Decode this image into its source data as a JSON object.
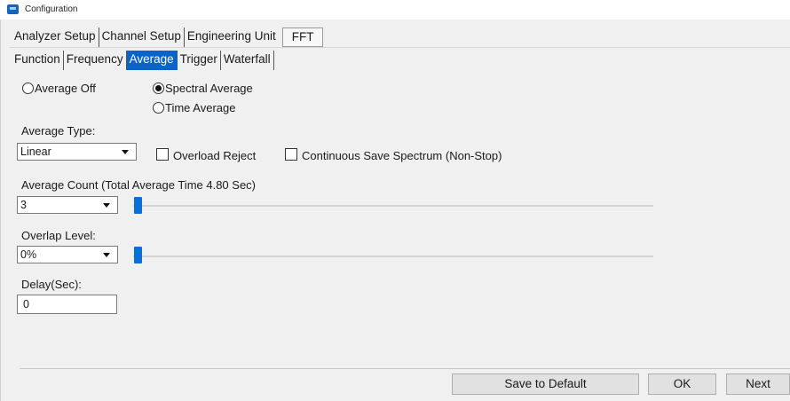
{
  "window": {
    "title": "Configuration",
    "icon": "app-window-icon"
  },
  "tabs_top": [
    "Analyzer Setup",
    "Channel Setup",
    "Engineering Unit",
    "FFT"
  ],
  "tabs_sub": [
    "Function",
    "Frequency",
    "Average",
    "Trigger",
    "Waterfall"
  ],
  "active_sub_tab": "Average",
  "mode": {
    "average_off": "Average Off",
    "spectral_average": "Spectral Average",
    "time_average": "Time Average",
    "selected": "Spectral Average"
  },
  "average_type": {
    "label": "Average Type:",
    "value": "Linear"
  },
  "overload_reject": {
    "label": "Overload Reject",
    "checked": false
  },
  "continuous_save": {
    "label": "Continuous Save Spectrum (Non-Stop)",
    "checked": false
  },
  "average_count": {
    "label": "Average Count (Total Average Time 4.80 Sec)",
    "value": "3",
    "slider_position": 0.0
  },
  "overlap_level": {
    "label": "Overlap Level:",
    "value": "0%",
    "slider_position": 0.0
  },
  "delay": {
    "label": "Delay(Sec):",
    "value": "0"
  },
  "buttons": {
    "save_default": "Save to Default",
    "ok": "OK",
    "next": "Next"
  },
  "colors": {
    "accent": "#0a63c8",
    "slider_thumb": "#0a6fd8",
    "background": "#f0f0f0"
  }
}
